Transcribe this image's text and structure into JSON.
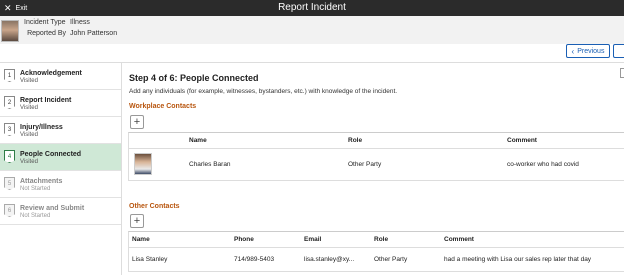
{
  "topbar": {
    "exit_label": "Exit",
    "title": "Report Incident"
  },
  "header": {
    "incident_type_label": "Incident Type",
    "incident_type_value": "Illness",
    "reported_by_label": "Reported By",
    "reported_by_value": "John Patterson"
  },
  "nav": {
    "previous_label": "Previous"
  },
  "steps": [
    {
      "num": "1",
      "name": "Acknowledgement",
      "status": "Visited"
    },
    {
      "num": "2",
      "name": "Report Incident",
      "status": "Visited"
    },
    {
      "num": "3",
      "name": "Injury/Illness",
      "status": "Visited"
    },
    {
      "num": "4",
      "name": "People Connected",
      "status": "Visited"
    },
    {
      "num": "5",
      "name": "Attachments",
      "status": "Not Started"
    },
    {
      "num": "6",
      "name": "Review and Submit",
      "status": "Not Started"
    }
  ],
  "main": {
    "title": "Step 4 of 6: People Connected",
    "description": "Add any individuals (for example, witnesses, bystanders, etc.) with knowledge of the incident.",
    "workplace": {
      "title": "Workplace Contacts",
      "headers": {
        "name": "Name",
        "role": "Role",
        "comment": "Comment"
      },
      "rows": [
        {
          "name": "Charles Baran",
          "role": "Other Party",
          "comment": "co-worker who had covid"
        }
      ]
    },
    "other": {
      "title": "Other Contacts",
      "headers": {
        "name": "Name",
        "phone": "Phone",
        "email": "Email",
        "role": "Role",
        "comment": "Comment"
      },
      "rows": [
        {
          "name": "Lisa Stanley",
          "phone": "714/989-5403",
          "email": "lisa.stanley@xy...",
          "role": "Other Party",
          "comment": "had a meeting with Lisa our sales rep later that day"
        }
      ]
    },
    "add_symbol": "+"
  },
  "colors": {
    "topbar": "#2b2b2b",
    "accent_blue": "#1a5fb4",
    "section_orange": "#b8560f",
    "active_step": "#cfe8d6"
  },
  "icons": {
    "exit": "close-icon",
    "previous": "chevron-left-icon",
    "add": "plus-icon"
  }
}
